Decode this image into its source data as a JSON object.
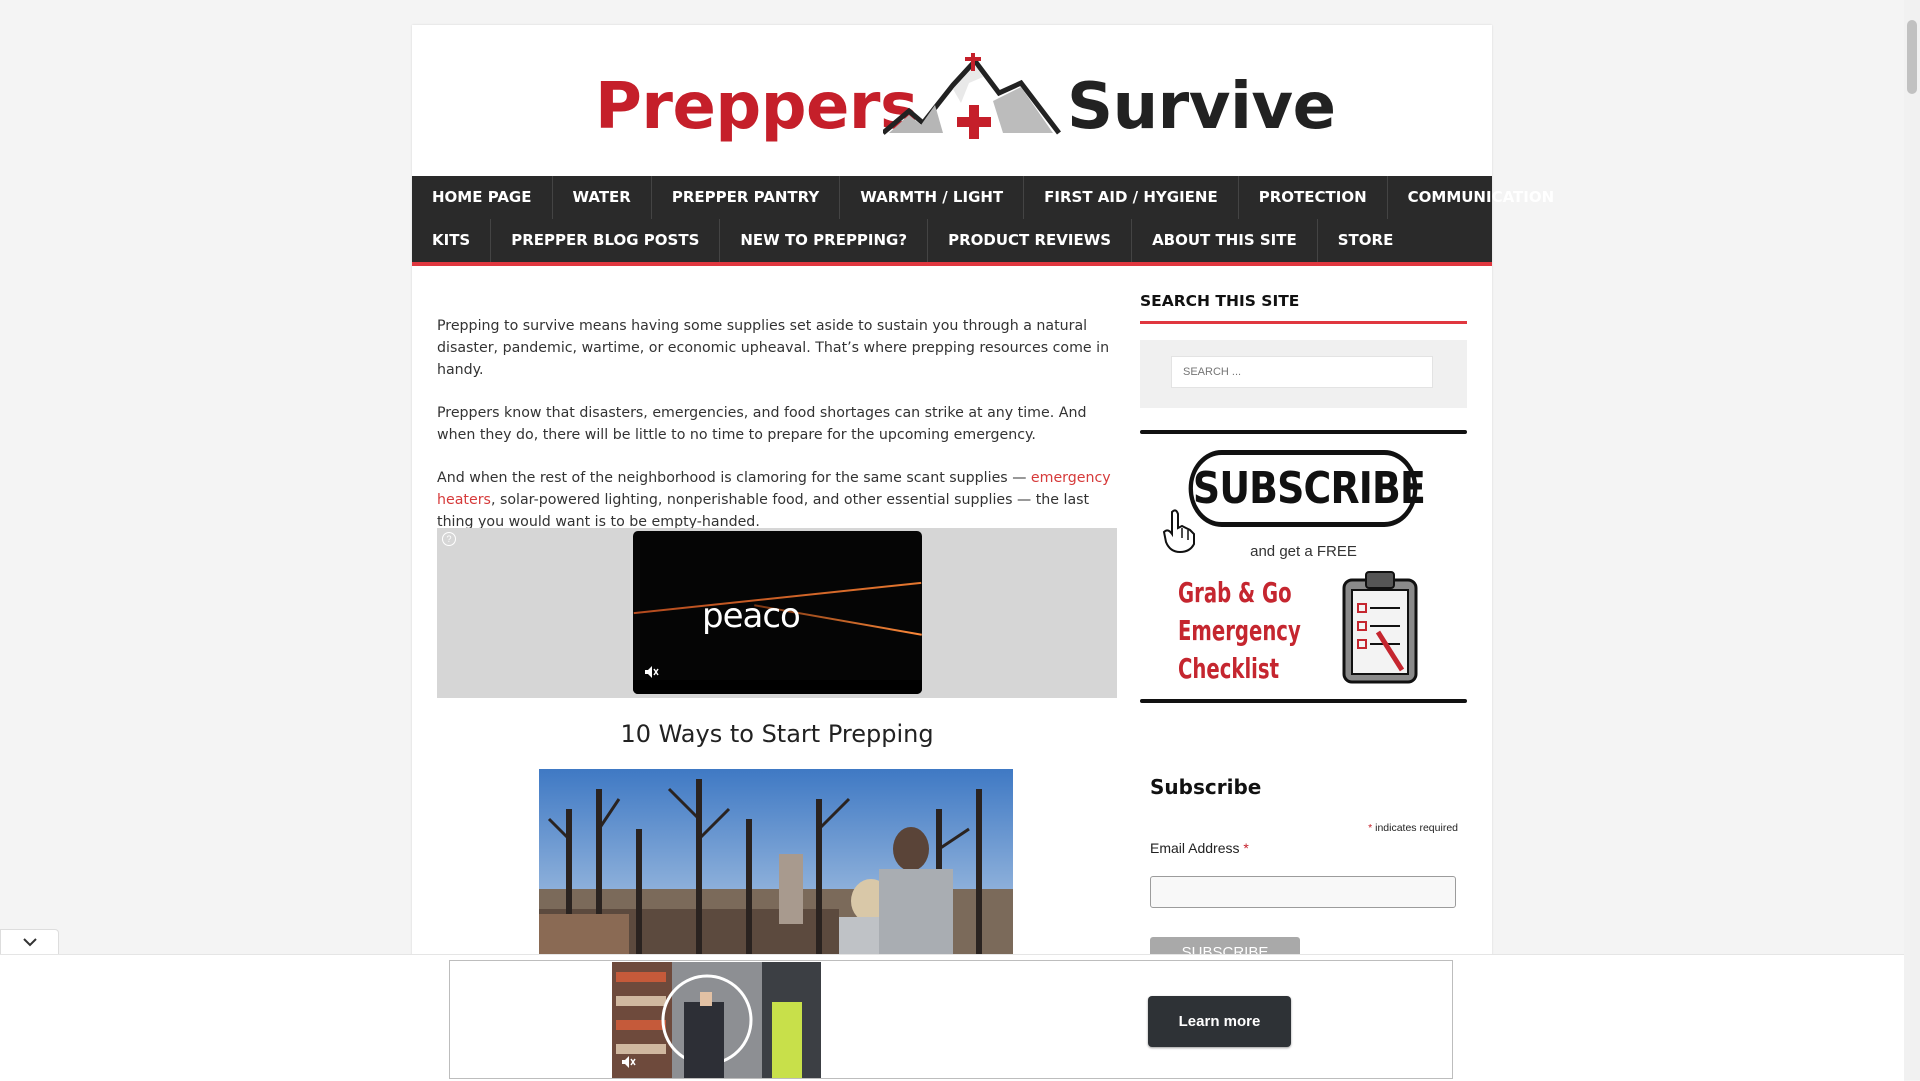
{
  "logo": {
    "left_word": "Preppers",
    "right_word": "Survive",
    "brand_red": "#c51f2a"
  },
  "nav": {
    "row1": [
      "HOME PAGE",
      "WATER",
      "PREPPER PANTRY",
      "WARMTH / LIGHT",
      "FIRST AID / HYGIENE",
      "PROTECTION",
      "COMMUNICATION"
    ],
    "row2": [
      "KITS",
      "PREPPER BLOG POSTS",
      "NEW TO PREPPING?",
      "PRODUCT REVIEWS",
      "ABOUT THIS SITE",
      "STORE"
    ],
    "accent_color": "#e0373f"
  },
  "content": {
    "p1": "Prepping to survive means having some supplies set aside to sustain you through a natural disaster, pandemic, wartime, or economic upheaval. That’s where prepping resources come in handy.",
    "p2": "Preppers know that disasters, emergencies, and food shortages can strike at any time. And when they do, there will be little to no time to prepare for the upcoming emergency.",
    "p3_before": "And when the rest of the neighborhood is clamoring for the same scant supplies — ",
    "p3_link": "emergency heaters",
    "p3_after": ", solar-powered lighting, nonperishable food, and other essential supplies — the last thing you would want is to be empty-handed.",
    "video_brand": "peaco",
    "section_title": "10 Ways to Start Prepping"
  },
  "sidebar": {
    "search_title": "SEARCH THIS SITE",
    "search_placeholder": "SEARCH ...",
    "banner_subscribe": "SUBSCRIBE",
    "banner_free": "and get a FREE",
    "banner_checklist": [
      "Grab & Go",
      "Emergency",
      "Checklist"
    ],
    "form_title": "Subscribe",
    "required_star": "*",
    "required_note": "indicates required",
    "email_label": "Email Address",
    "subscribe_button": "SUBSCRIBE"
  },
  "ad": {
    "learn_more": "Learn more"
  },
  "icons": {
    "help": "help-circle-icon",
    "mute": "mute-icon",
    "hand": "pointing-hand-icon",
    "clipboard": "clipboard-icon",
    "chevron": "chevron-down-icon"
  }
}
